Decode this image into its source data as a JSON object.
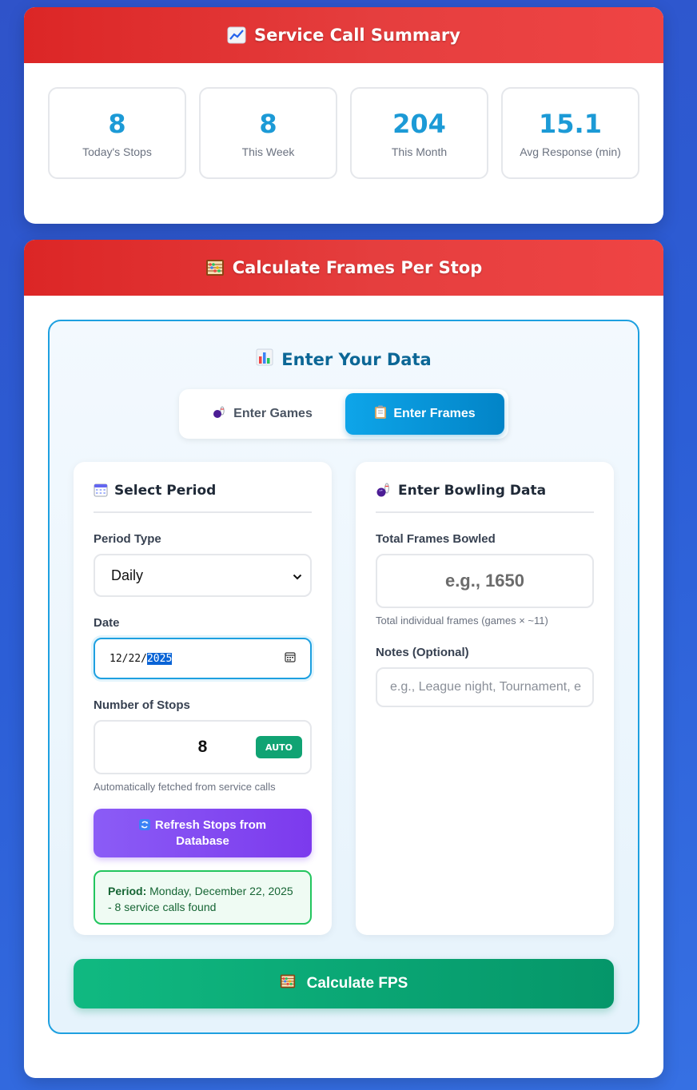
{
  "summary": {
    "title": "Service Call Summary",
    "icon": "chart-increasing-icon",
    "stats": [
      {
        "value": "8",
        "label": "Today's Stops"
      },
      {
        "value": "8",
        "label": "This Week"
      },
      {
        "value": "204",
        "label": "This Month"
      },
      {
        "value": "15.1",
        "label": "Avg Response (min)"
      }
    ]
  },
  "calculator": {
    "title": "Calculate Frames Per Stop",
    "icon": "abacus-icon",
    "panel_title": "Enter Your Data",
    "panel_icon": "bar-chart-icon",
    "mode_toggle": {
      "games_label": "Enter Games",
      "frames_label": "Enter Frames",
      "active": "frames"
    },
    "period": {
      "title": "Select Period",
      "icon": "calendar-icon",
      "period_type_label": "Period Type",
      "period_type_value": "Daily",
      "date_label": "Date",
      "date_month": "12",
      "date_day": "22",
      "date_year": "2025",
      "stops_label": "Number of Stops",
      "stops_value": "8",
      "auto_badge": "AUTO",
      "stops_hint": "Automatically fetched from service calls",
      "refresh_label": "Refresh Stops from Database",
      "info_prefix": "Period:",
      "info_text": "Monday, December 22, 2025 - 8 service calls found"
    },
    "bowling": {
      "title": "Enter Bowling Data",
      "icon": "bowling-icon",
      "frames_label": "Total Frames Bowled",
      "frames_placeholder": "e.g., 1650",
      "frames_hint": "Total individual frames (games × ~11)",
      "notes_label": "Notes (Optional)",
      "notes_placeholder": "e.g., League night, Tournament, e"
    },
    "calculate_label": "Calculate FPS"
  },
  "colors": {
    "header_red": "#dc2626",
    "stat_blue": "#1c9ad6",
    "active_toggle": "#0ea5e9",
    "refresh_purple": "#7c3aed",
    "calc_green": "#10b981"
  }
}
